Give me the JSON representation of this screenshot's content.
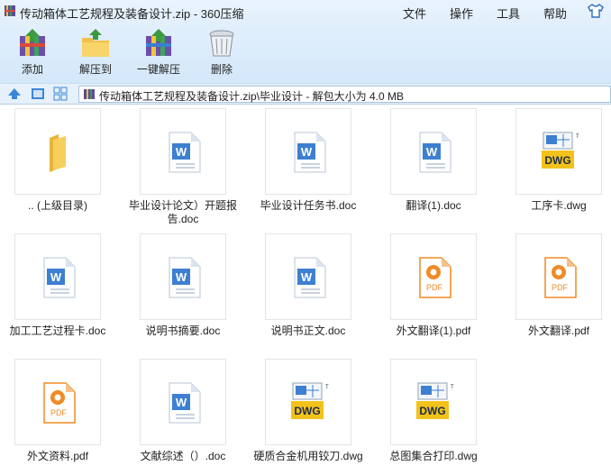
{
  "window": {
    "title": "传动箱体工艺规程及装备设计.zip - 360压缩"
  },
  "menu": [
    "文件",
    "操作",
    "工具",
    "帮助"
  ],
  "toolbar": [
    {
      "label": "添加",
      "icon": "add-archive-icon"
    },
    {
      "label": "解压到",
      "icon": "extract-folder-icon"
    },
    {
      "label": "一键解压",
      "icon": "one-click-extract-icon"
    },
    {
      "label": "删除",
      "icon": "trash-can-icon"
    }
  ],
  "address": {
    "path": "传动箱体工艺规程及装备设计.zip\\毕业设计 - 解包大小为 4.0 MB"
  },
  "files": [
    {
      "name": ".. (上级目录)",
      "type": "folder"
    },
    {
      "name": "毕业设计论文）开题报告.doc",
      "type": "doc"
    },
    {
      "name": "毕业设计任务书.doc",
      "type": "doc"
    },
    {
      "name": "翻译(1).doc",
      "type": "doc"
    },
    {
      "name": "工序卡.dwg",
      "type": "dwg"
    },
    {
      "name": "加工工艺过程卡.doc",
      "type": "doc"
    },
    {
      "name": "说明书摘要.doc",
      "type": "doc"
    },
    {
      "name": "说明书正文.doc",
      "type": "doc"
    },
    {
      "name": "外文翻译(1).pdf",
      "type": "pdf"
    },
    {
      "name": "外文翻译.pdf",
      "type": "pdf"
    },
    {
      "name": "外文资料.pdf",
      "type": "pdf"
    },
    {
      "name": "文献综述（）.doc",
      "type": "doc"
    },
    {
      "name": "硬质合金机用铰刀.dwg",
      "type": "dwg"
    },
    {
      "name": "总图集合打印.dwg",
      "type": "dwg"
    }
  ],
  "icon_labels": {
    "doc": "W",
    "pdf": "PDF",
    "dwg": "DWG",
    "tm": "TM"
  },
  "colors": {
    "doc_blue": "#3d7fd1",
    "pdf_orange": "#f08a24",
    "dwg_yellow": "#f2c21b",
    "folder": "#f5c84c",
    "accent": "#2a6ebd"
  }
}
